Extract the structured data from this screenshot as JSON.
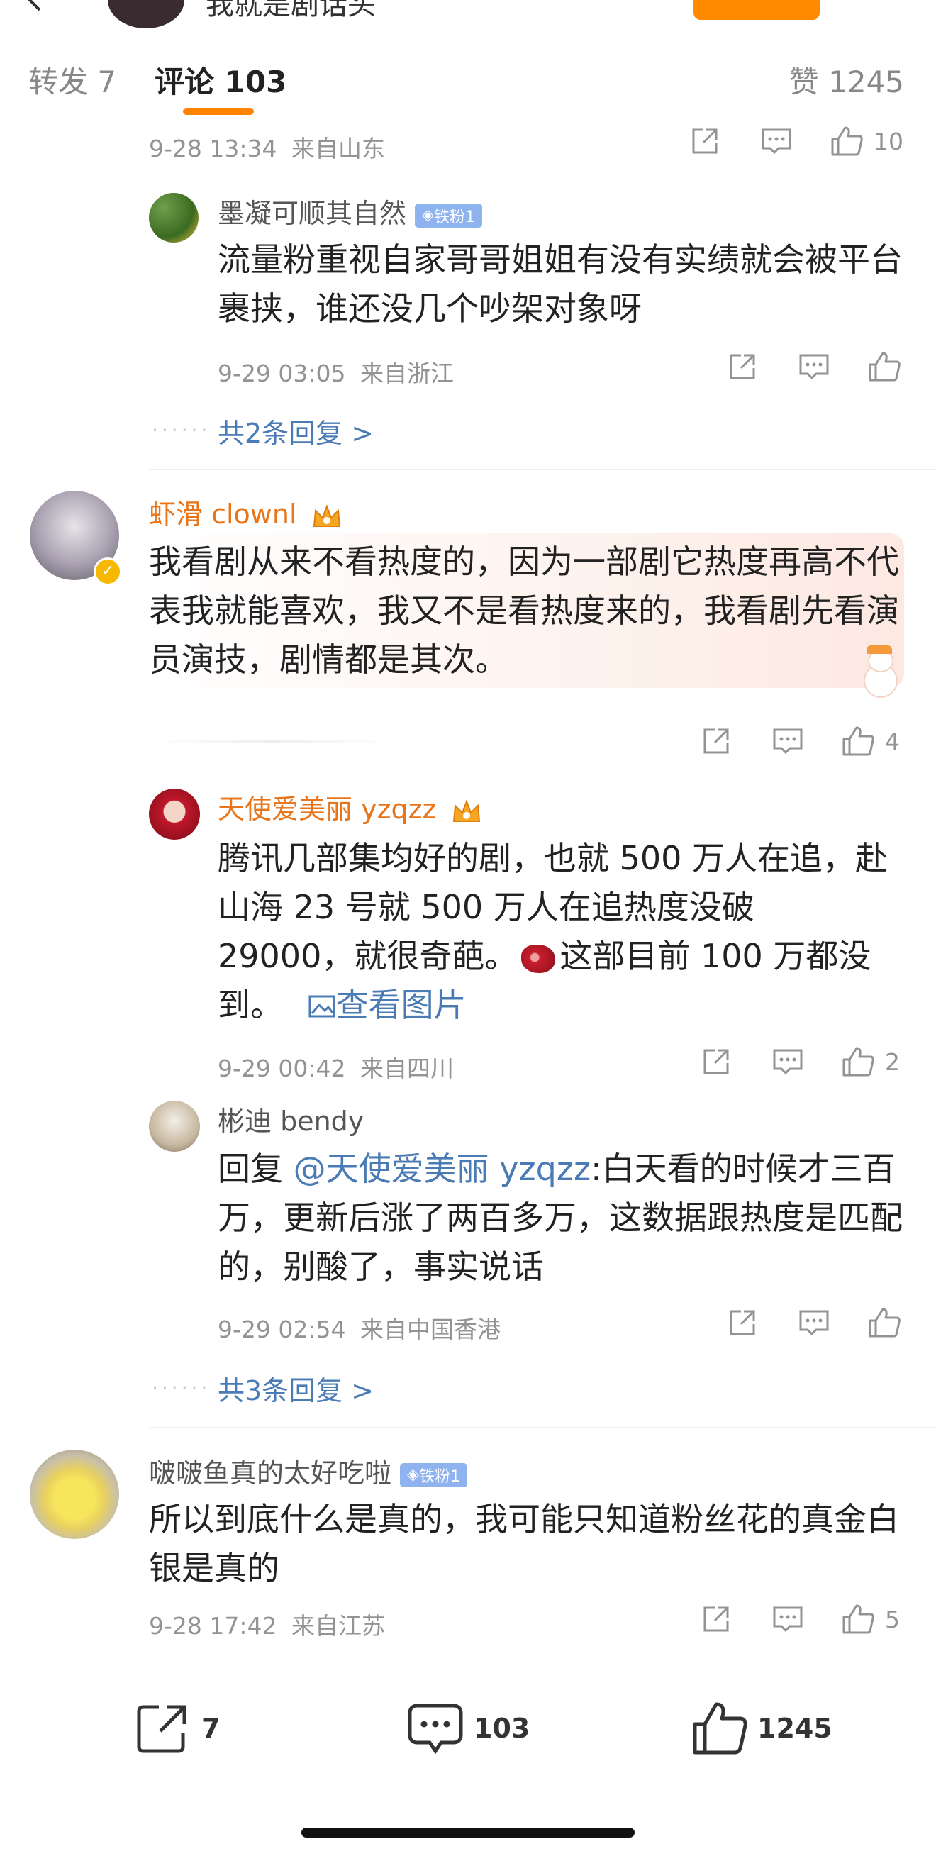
{
  "header": {
    "title_partial": "我就是剧话头"
  },
  "tabs": {
    "repost_label": "转发",
    "repost_count": "7",
    "comment_label": "评论",
    "comment_count": "103",
    "like_label": "赞",
    "like_count": "1245"
  },
  "thread_top": {
    "time": "9-28 13:34",
    "location": "来自山东",
    "likes": "10"
  },
  "reply1": {
    "name": "墨凝可顺其自然",
    "badge": "铁粉1",
    "text": "流量粉重视自家哥哥姐姐有没有实绩就会被平台裹挟，谁还没几个吵架对象呀",
    "time": "9-29 03:05",
    "location": "来自浙江"
  },
  "more1": "共2条回复 >",
  "comment2": {
    "name": "虾滑 clownl",
    "text": "我看剧从来不看热度的，因为一部剧它热度再高不代表我就能喜欢，我又不是看热度来的，我看剧先看演员演技，剧情都是其次。",
    "likes": "4"
  },
  "reply2": {
    "name": "天使爱美丽 yzqzz",
    "text_before": "腾讯几部集均好的剧，也就 500 万人在追，赴山海 23 号就 500 万人在追热度没破 29000，就很奇葩。",
    "text_after": "这部目前 100 万都没到。",
    "image_link": "查看图片",
    "time": "9-29 00:42",
    "location": "来自四川",
    "likes": "2"
  },
  "reply3": {
    "name": "彬迪 bendy",
    "prefix": "回复 ",
    "mention": "@天使爱美丽 yzqzz",
    "text": ":白天看的时候才三百万，更新后涨了两百多万，这数据跟热度是匹配的，别酸了，事实说话",
    "time": "9-29 02:54",
    "location": "来自中国香港"
  },
  "more2": "共3条回复 >",
  "comment3": {
    "name": "啵啵鱼真的太好吃啦",
    "badge": "铁粉1",
    "text": "所以到底什么是真的，我可能只知道粉丝花的真金白银是真的",
    "time": "9-28 17:42",
    "location": "来自江苏",
    "likes": "5"
  },
  "bottom_bar": {
    "repost": "7",
    "comment": "103",
    "like": "1245"
  },
  "colors": {
    "accent": "#ff8200",
    "link": "#4a7bb4",
    "orange_name": "#e8751a",
    "badge": "#8fb3ee"
  },
  "icons": [
    "back-icon",
    "share-icon",
    "comment-icon",
    "like-icon",
    "vip-crown-icon",
    "verified-icon",
    "image-icon"
  ]
}
